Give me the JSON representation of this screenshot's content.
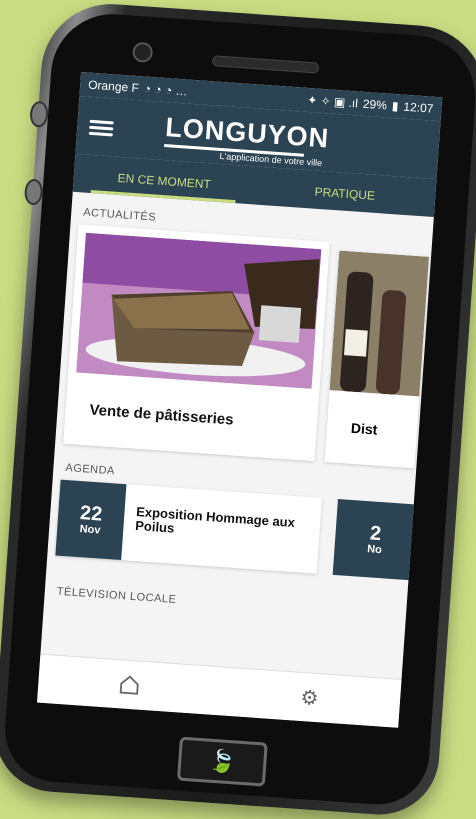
{
  "status": {
    "carrier": "Orange F",
    "battery": "29%",
    "time": "12:07"
  },
  "app": {
    "title": "LONGUYON",
    "subtitle": "L'application de votre ville"
  },
  "tabs": [
    "EN CE MOMENT",
    "PRATIQUE"
  ],
  "sections": {
    "news": "ACTUALITÉS",
    "agenda": "AGENDA",
    "tv": "TÉLEVISION LOCALE"
  },
  "news": [
    {
      "title": "Vente de pâtisseries"
    },
    {
      "title": "Dist"
    }
  ],
  "agenda": [
    {
      "day": "22",
      "month": "Nov",
      "title": "Exposition Hommage aux Poilus"
    },
    {
      "day": "2",
      "month": "No"
    }
  ]
}
